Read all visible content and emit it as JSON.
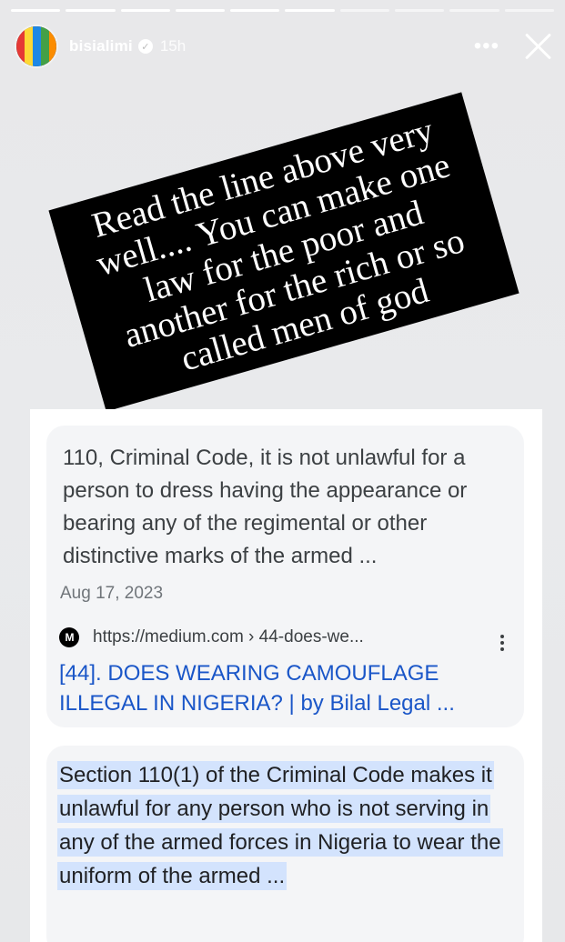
{
  "story": {
    "progress_total": 10,
    "progress_done": 6
  },
  "header": {
    "username": "bisialimi",
    "time": "15h",
    "more_label": "•••"
  },
  "note": {
    "text": "Read the line above very well.... You can make one law for the poor and another for the rich or so called men of god"
  },
  "result1": {
    "snippet": "110, Criminal Code, it is not unlawful for a person to dress having the appearance or bearing any of the regimental or other distinctive marks of the armed ...",
    "date": "Aug 17, 2023",
    "favicon_text": "M",
    "url": "https://medium.com › 44-does-we...",
    "title": "[44]. DOES WEARING CAMOUFLAGE ILLEGAL IN NIGERIA? | by Bilal Legal ..."
  },
  "result2": {
    "highlight": "Section 110(1) of the Criminal Code makes it unlawful for any person who is not serving in any of the armed forces in Nigeria to wear the uniform of the armed ..."
  },
  "colors": {
    "link": "#1a56c8",
    "highlight": "#d3e3fd"
  }
}
